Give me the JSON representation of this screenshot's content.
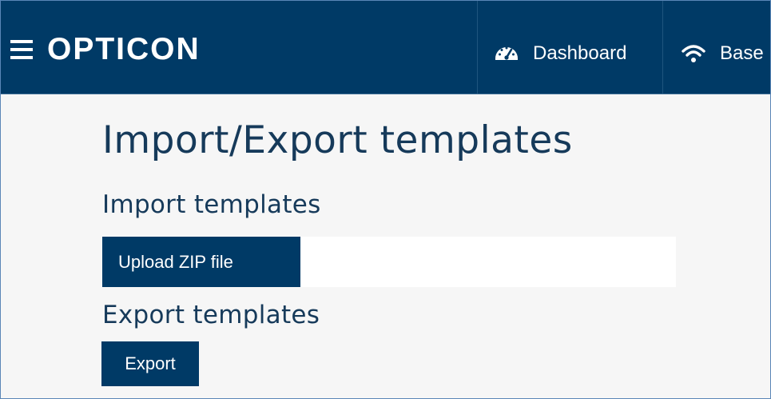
{
  "header": {
    "brand": "OPTICON",
    "nav": [
      {
        "label": "Dashboard",
        "icon": "dashboard-icon"
      },
      {
        "label": "Base",
        "icon": "wifi-icon"
      }
    ]
  },
  "main": {
    "title": "Import/Export templates",
    "import_section": {
      "title": "Import templates",
      "upload_button": "Upload ZIP file",
      "file_name": ""
    },
    "export_section": {
      "title": "Export templates",
      "export_button": "Export"
    }
  },
  "colors": {
    "brand_navy": "#003a66",
    "heading": "#163a5a",
    "background": "#f6f6f6"
  }
}
